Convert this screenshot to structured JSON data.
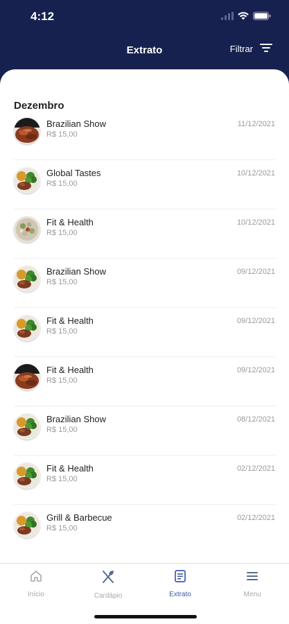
{
  "status": {
    "time": "4:12"
  },
  "header": {
    "title": "Extrato",
    "filter_label": "Filtrar"
  },
  "month": "Dezembro",
  "transactions": [
    {
      "name": "Brazilian Show",
      "amount": "R$ 15,00",
      "date": "11/12/2021",
      "image": "steak"
    },
    {
      "name": "Global Tastes",
      "amount": "R$ 15,00",
      "date": "10/12/2021",
      "image": "broccoli-plate"
    },
    {
      "name": "Fit & Health",
      "amount": "R$ 15,00",
      "date": "10/12/2021",
      "image": "salad"
    },
    {
      "name": "Brazilian Show",
      "amount": "R$ 15,00",
      "date": "09/12/2021",
      "image": "broccoli-plate"
    },
    {
      "name": "Fit & Health",
      "amount": "R$ 15,00",
      "date": "09/12/2021",
      "image": "broccoli-plate"
    },
    {
      "name": "Fit & Health",
      "amount": "R$ 15,00",
      "date": "09/12/2021",
      "image": "steak"
    },
    {
      "name": "Brazilian Show",
      "amount": "R$ 15,00",
      "date": "08/12/2021",
      "image": "broccoli-plate"
    },
    {
      "name": "Fit & Health",
      "amount": "R$ 15,00",
      "date": "02/12/2021",
      "image": "broccoli-plate"
    },
    {
      "name": "Grill & Barbecue",
      "amount": "R$ 15,00",
      "date": "02/12/2021",
      "image": "broccoli-plate"
    }
  ],
  "tabs": [
    {
      "label": "Início",
      "icon": "home-icon",
      "active": false
    },
    {
      "label": "Cardápio",
      "icon": "utensils-icon",
      "active": false
    },
    {
      "label": "Extrato",
      "icon": "receipt-icon",
      "active": true
    },
    {
      "label": "Menu",
      "icon": "hamburger-menu-icon",
      "active": false
    }
  ],
  "colors": {
    "navy": "#16214f",
    "active_tab": "#3d5aa8",
    "muted": "#9a9a9a"
  }
}
